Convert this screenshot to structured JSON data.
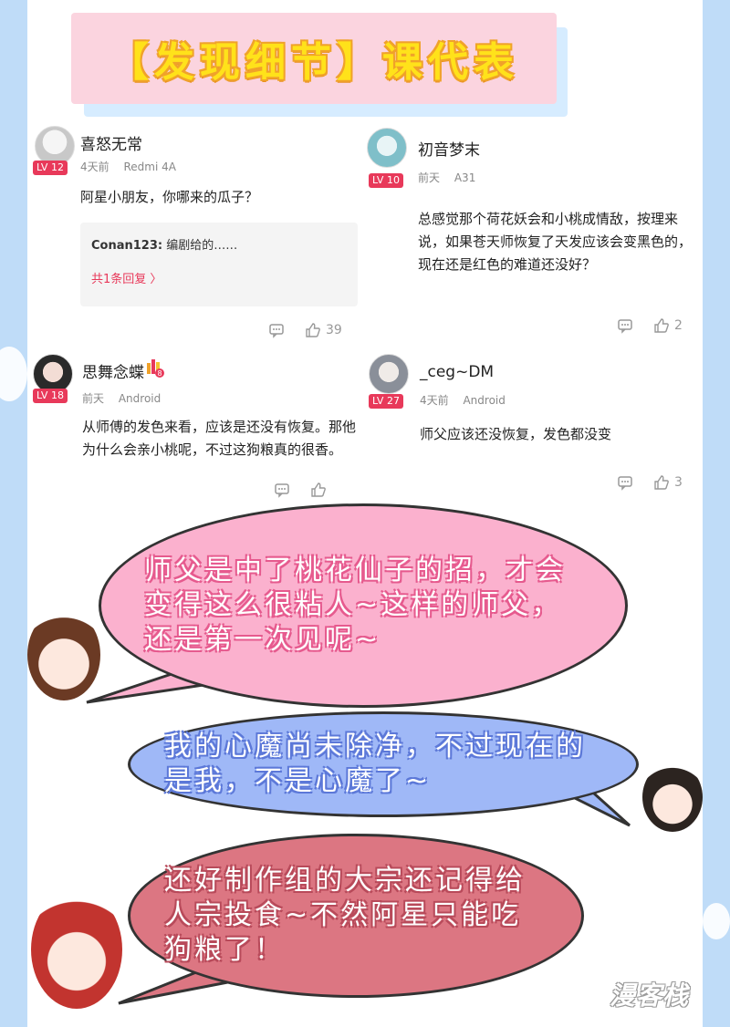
{
  "banner": {
    "title": "【发现细节】课代表"
  },
  "comments": [
    {
      "username": "喜怒无常",
      "level": "LV 12",
      "time": "4天前",
      "device": "Redmi 4A",
      "text": "阿星小朋友，你哪来的瓜子？",
      "reply": {
        "user": "Conan123:",
        "text": " 编剧给的……",
        "count": "共1条回复 〉"
      },
      "likes": "39"
    },
    {
      "username": "初音梦末",
      "level": "LV 10",
      "time": "前天",
      "device": "A31",
      "text": "总感觉那个荷花妖会和小桃成情敌，按理来说，如果苍天师恢复了天发应该会变黑色的，现在还是红色的难道还没好？",
      "likes": "2"
    },
    {
      "username": "思舞念蝶",
      "level": "LV 18",
      "medal_level": "8",
      "time": "前天",
      "device": "Android",
      "text": "从师傅的发色来看，应该是还没有恢复。那他为什么会亲小桃呢，不过这狗粮真的很香。",
      "likes": ""
    },
    {
      "username": "_ceg~DM",
      "level": "LV 27",
      "time": "4天前",
      "device": "Android",
      "text": "师父应该还没恢复，发色都没变",
      "likes": "3"
    }
  ],
  "bubbles": [
    {
      "text": "师父是中了桃花仙子的招，才会变得这么很粘人~这样的师父，还是第一次见呢~",
      "color": "#fbb1ce"
    },
    {
      "text": "我的心魔尚未除净，不过现在的是我，不是心魔了~",
      "color": "#9fb8f7"
    },
    {
      "text": "还好制作组的大宗还记得给人宗投食~不然阿星只能吃狗粮了！",
      "color": "#dc7682"
    }
  ],
  "watermark": "漫客栈",
  "colors": {
    "accent": "#e8395a",
    "title": "#ffe21a",
    "banner_bg": "#fbd4df"
  },
  "icons": [
    "comment-icon",
    "thumbs-up-icon"
  ]
}
